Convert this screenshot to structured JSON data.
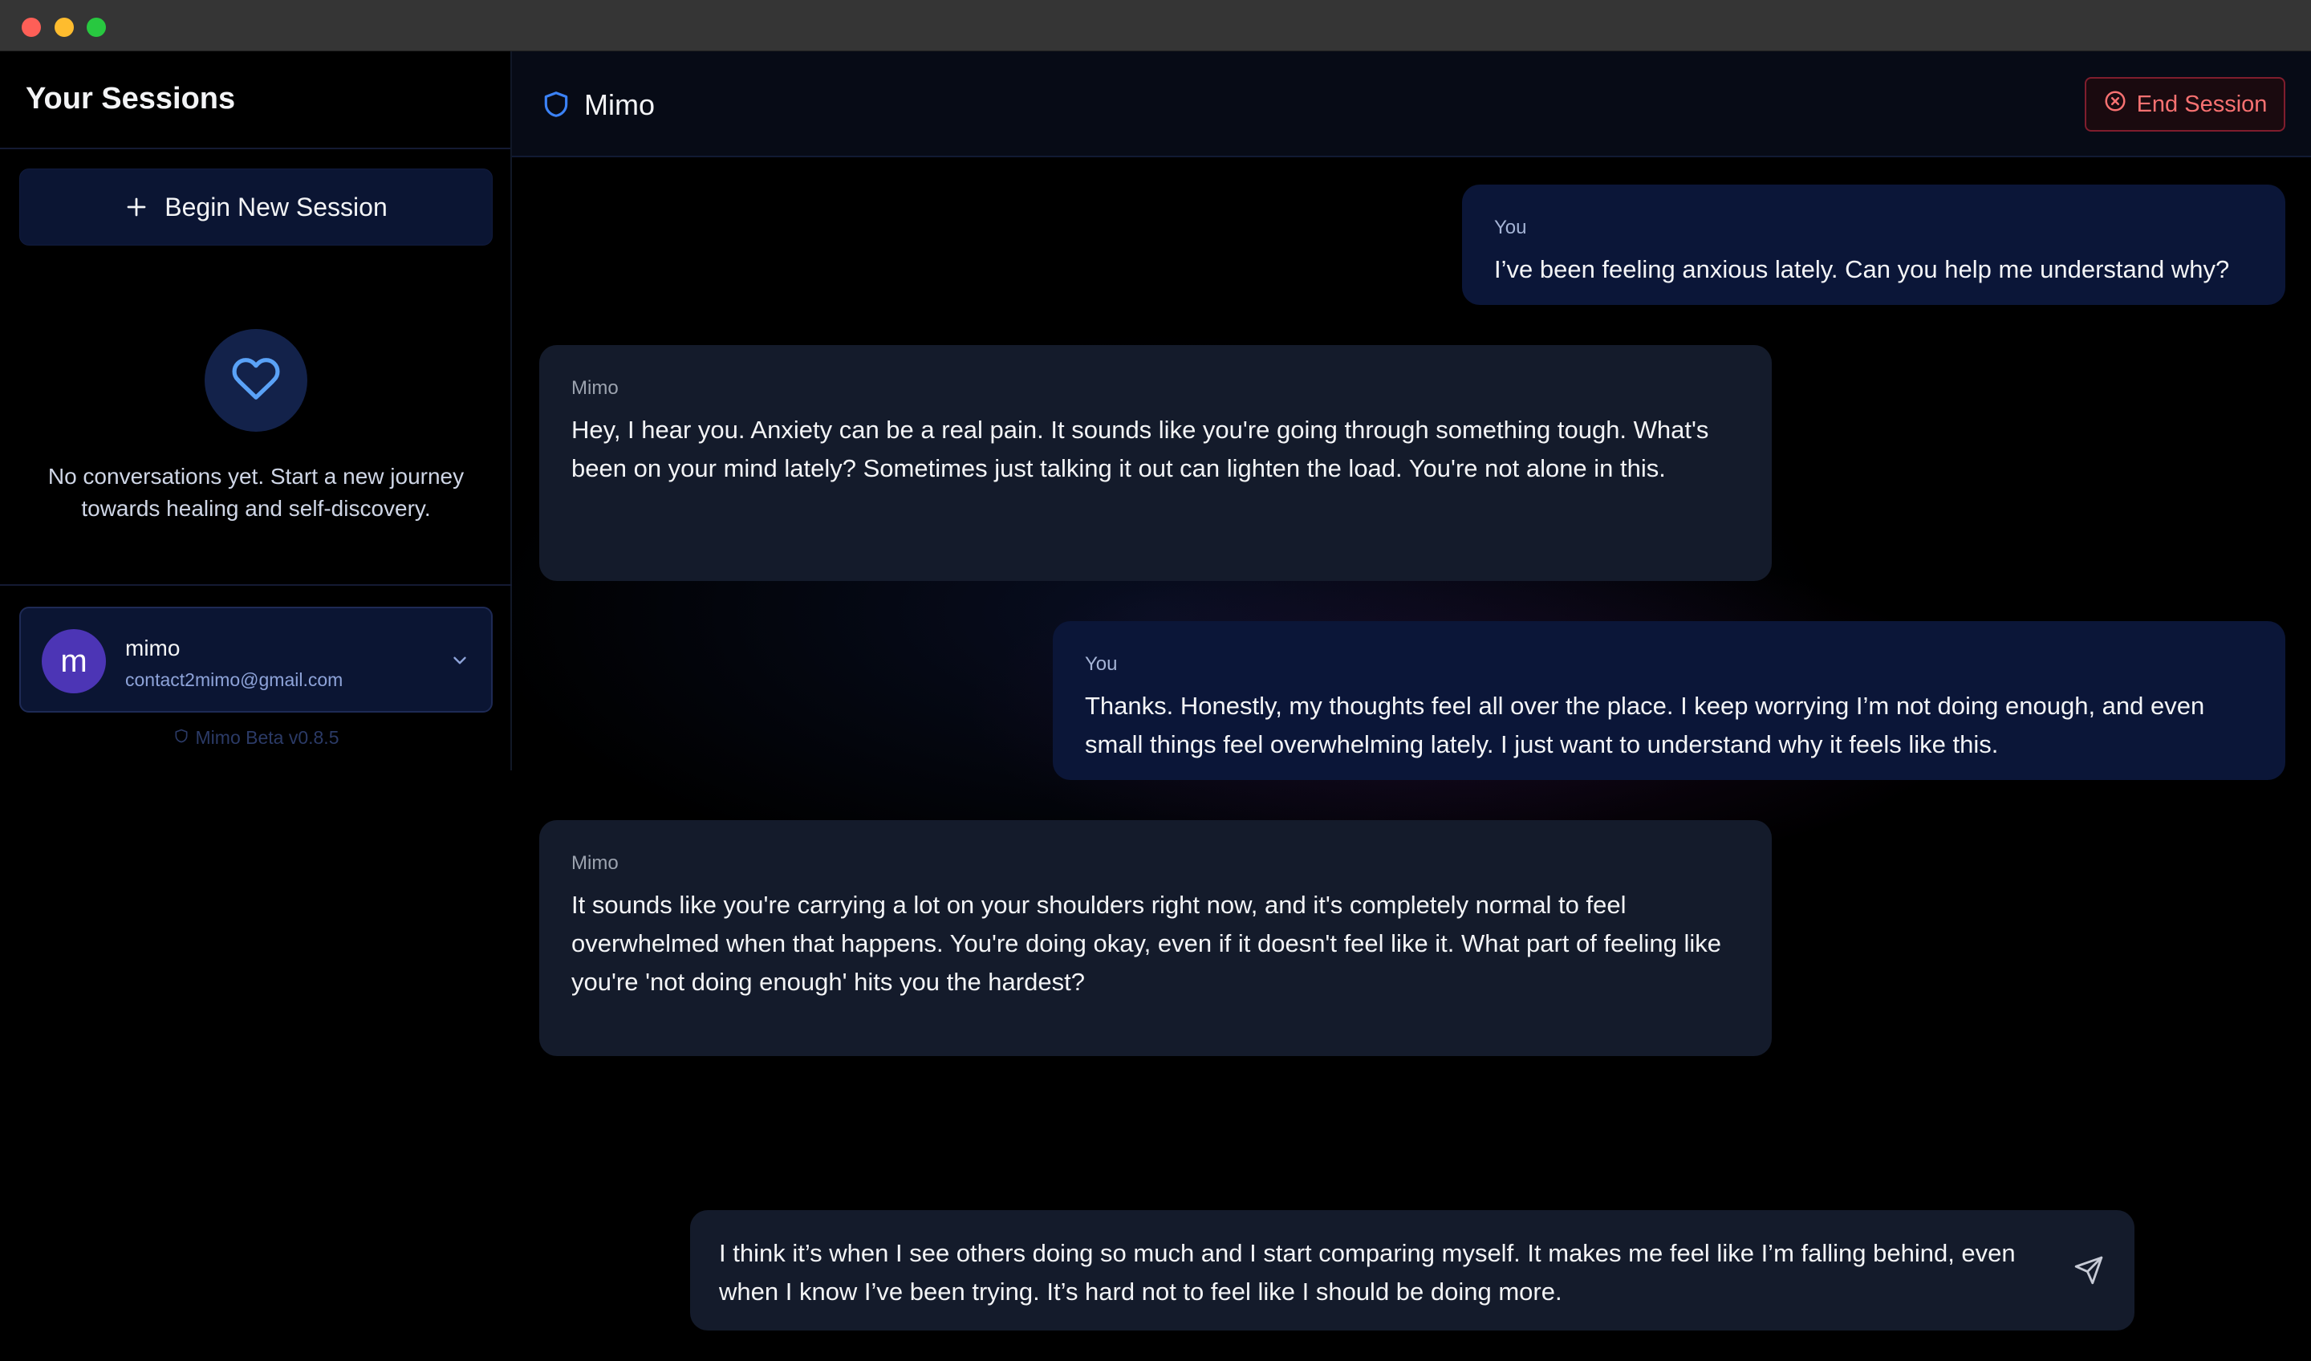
{
  "sidebar": {
    "title": "Your Sessions",
    "new_session_label": "Begin New Session",
    "empty_text": "No conversations yet. Start a new journey towards healing and self-discovery.",
    "user": {
      "initial": "m",
      "name": "mimo",
      "email": "contact2mimo@gmail.com"
    },
    "version": "Mimo Beta v0.8.5"
  },
  "header": {
    "title": "Mimo",
    "end_session_label": "End Session"
  },
  "messages": [
    {
      "sender": "You",
      "text": "I’ve been feeling anxious lately. Can you help me understand why?"
    },
    {
      "sender": "Mimo",
      "text": "Hey, I hear you. Anxiety can be a real pain. It sounds like you're going through something tough. What's been on your mind lately? Sometimes just talking it out can lighten the load. You're not alone in this."
    },
    {
      "sender": "You",
      "text": "Thanks. Honestly, my thoughts feel all over the place. I keep worrying I’m not doing enough, and even small things feel overwhelming lately. I just want to understand why it feels like this."
    },
    {
      "sender": "Mimo",
      "text": "It sounds like you're carrying a lot on your shoulders right now, and it's completely normal to feel overwhelmed when that happens. You're doing okay, even if it doesn't feel like it. What part of feeling like you're 'not doing enough' hits you the hardest?"
    }
  ],
  "composer": {
    "value": "I think it’s when I see others doing so much and I start comparing myself. It makes me feel like I’m falling behind, even when I know I’ve been trying. It’s hard not to feel like I should be doing more."
  },
  "colors": {
    "accent": "#3b82f6",
    "danger": "#f87171",
    "avatar": "#4c35b5"
  },
  "icons": [
    "plus-icon",
    "heart-icon",
    "chevron-down-icon",
    "shield-icon",
    "x-circle-icon",
    "send-icon"
  ]
}
